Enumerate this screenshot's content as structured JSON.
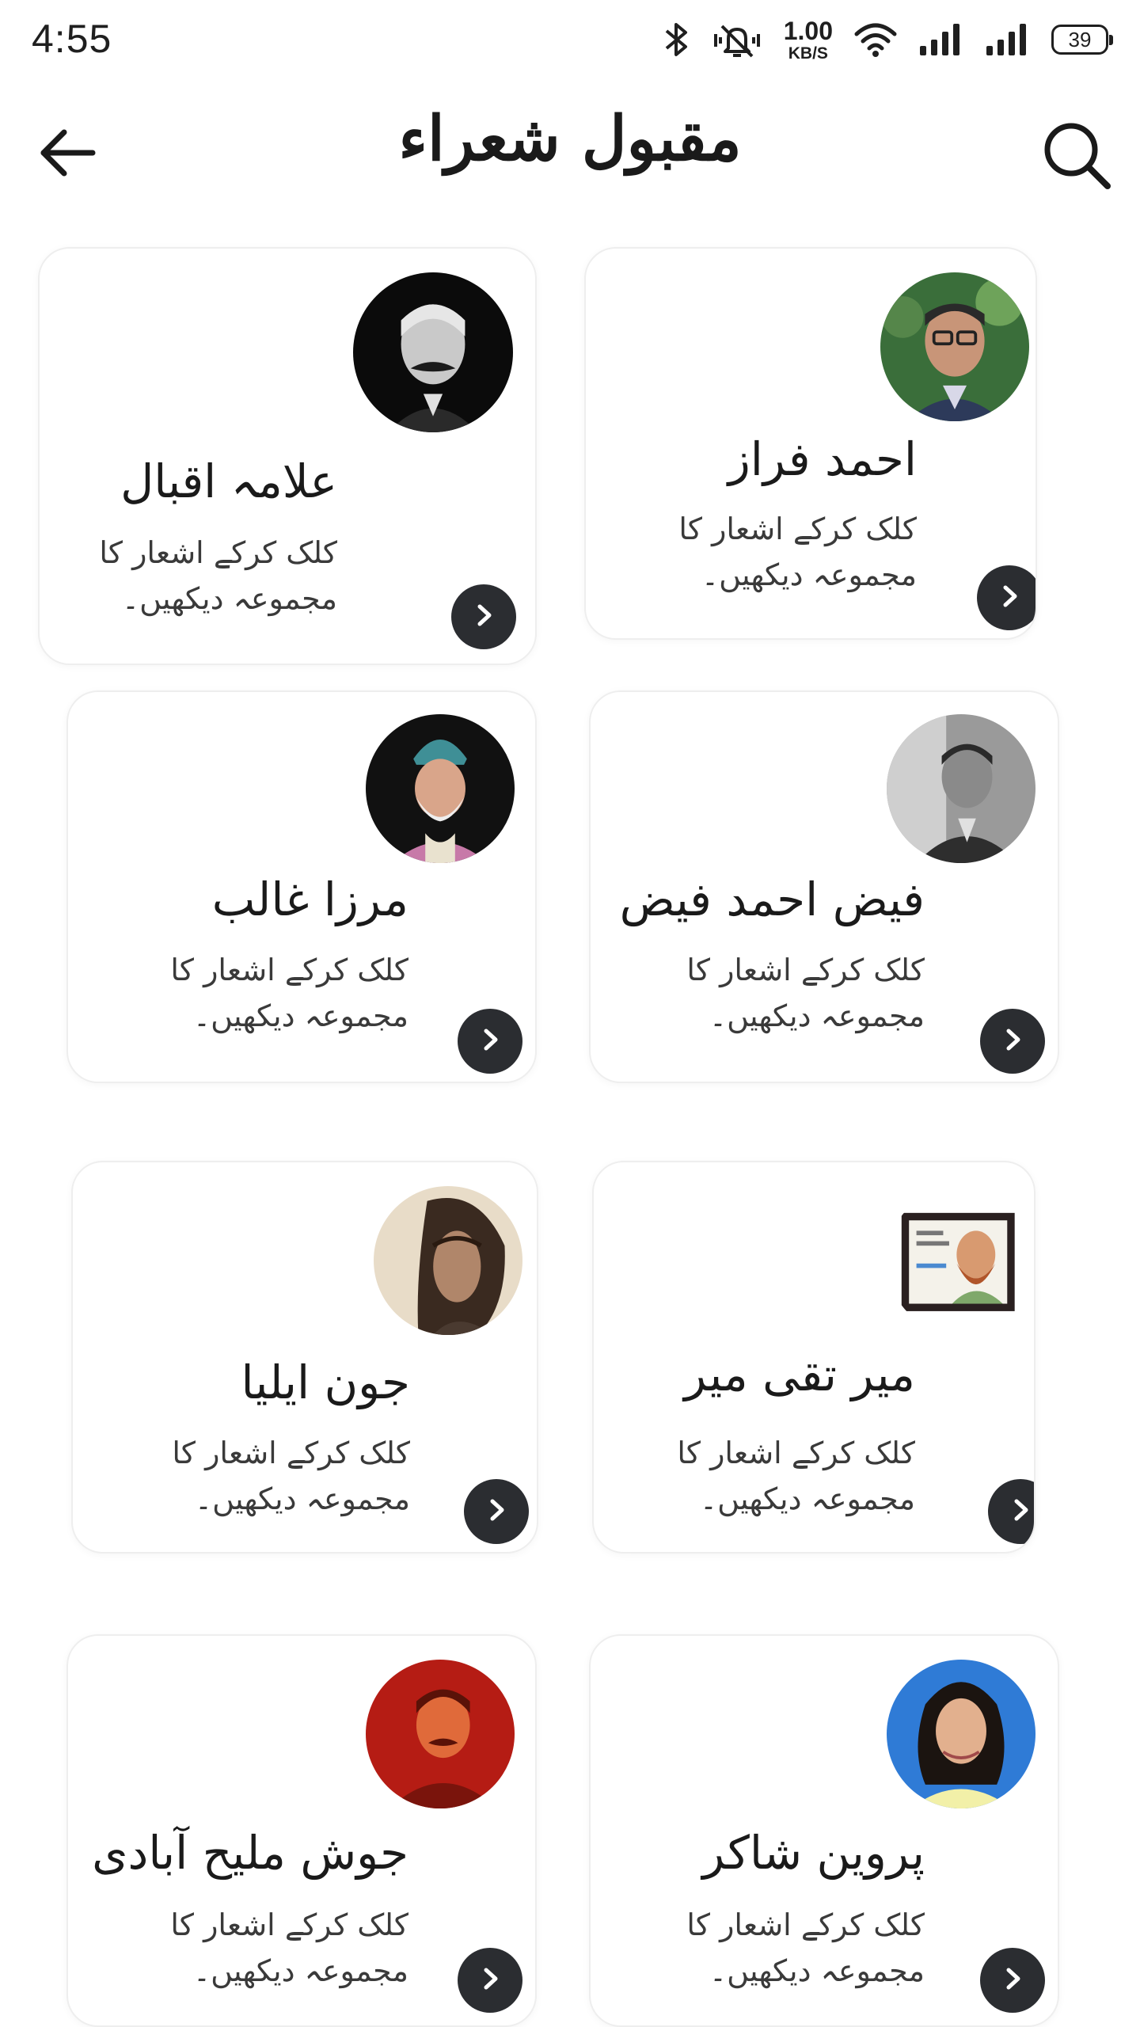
{
  "status_bar": {
    "time": "4:55",
    "net_speed_value": "1.00",
    "net_speed_unit": "KB/S",
    "battery": "39",
    "icons": [
      "bluetooth-icon",
      "mute-vibrate-icon",
      "wifi-icon",
      "signal-icon",
      "signal-icon"
    ]
  },
  "header": {
    "title": "مقبول شعراء",
    "back_icon": "arrow-left-icon",
    "search_icon": "search-icon"
  },
  "poets": [
    {
      "name": "علامہ اقبال",
      "desc": "کلک کرکے اشعار کا مجموعہ دیکھیں۔"
    },
    {
      "name": "احمد فراز",
      "desc": "کلک کرکے اشعار کا مجموعہ دیکھیں۔"
    },
    {
      "name": "مرزا غالب",
      "desc": "کلک کرکے اشعار کا مجموعہ دیکھیں۔"
    },
    {
      "name": "فیض احمد فیض",
      "desc": "کلک کرکے اشعار کا مجموعہ دیکھیں۔"
    },
    {
      "name": "جون ایلیا",
      "desc": "کلک کرکے اشعار کا مجموعہ دیکھیں۔"
    },
    {
      "name": "میر تقی میر",
      "desc": "کلک کرکے اشعار کا مجموعہ دیکھیں۔"
    },
    {
      "name": "جوش ملیح آبادی",
      "desc": "کلک کرکے اشعار کا مجموعہ دیکھیں۔"
    },
    {
      "name": "پروین شاکر",
      "desc": "کلک کرکے اشعار کا مجموعہ دیکھیں۔"
    }
  ],
  "colors": {
    "arrow_button_bg": "#2b2d31",
    "card_border": "#eeeeee"
  }
}
